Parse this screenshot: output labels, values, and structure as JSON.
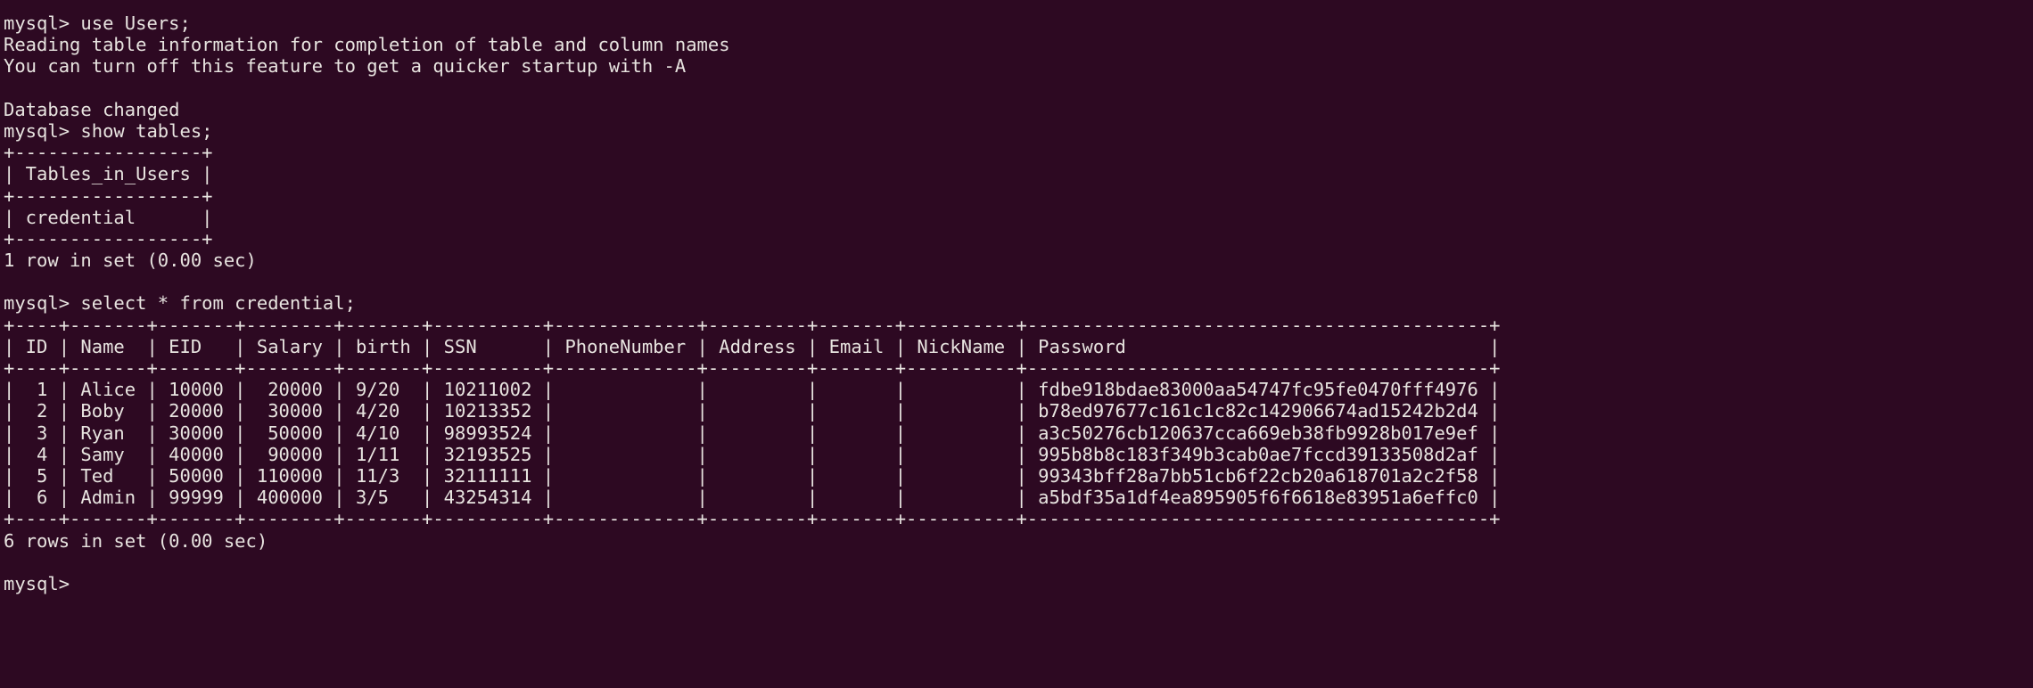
{
  "terminal": {
    "app": "mysql-client-terminal",
    "colors": {
      "background": "#2d0922",
      "foreground": "#e8e4e0"
    },
    "prompt": "mysql>",
    "lines": [
      "mysql> use Users;",
      "Reading table information for completion of table and column names",
      "You can turn off this feature to get a quicker startup with -A",
      "",
      "Database changed",
      "mysql> show tables;",
      "+-----------------+",
      "| Tables_in_Users |",
      "+-----------------+",
      "| credential      |",
      "+-----------------+",
      "1 row in set (0.00 sec)",
      "",
      "mysql> select * from credential;",
      "+----+-------+-------+--------+-------+----------+-------------+---------+-------+----------+------------------------------------------+",
      "| ID | Name  | EID   | Salary | birth | SSN      | PhoneNumber | Address | Email | NickName | Password                                 |",
      "+----+-------+-------+--------+-------+----------+-------------+---------+-------+----------+------------------------------------------+",
      "|  1 | Alice | 10000 |  20000 | 9/20  | 10211002 |             |         |       |          | fdbe918bdae83000aa54747fc95fe0470fff4976 |",
      "|  2 | Boby  | 20000 |  30000 | 4/20  | 10213352 |             |         |       |          | b78ed97677c161c1c82c142906674ad15242b2d4 |",
      "|  3 | Ryan  | 30000 |  50000 | 4/10  | 98993524 |             |         |       |          | a3c50276cb120637cca669eb38fb9928b017e9ef |",
      "|  4 | Samy  | 40000 |  90000 | 1/11  | 32193525 |             |         |       |          | 995b8b8c183f349b3cab0ae7fccd39133508d2af |",
      "|  5 | Ted   | 50000 | 110000 | 11/3  | 32111111 |             |         |       |          | 99343bff28a7bb51cb6f22cb20a618701a2c2f58 |",
      "|  6 | Admin | 99999 | 400000 | 3/5   | 43254314 |             |         |       |          | a5bdf35a1df4ea895905f6f6618e83951a6effc0 |",
      "+----+-------+-------+--------+-------+----------+-------------+---------+-------+----------+------------------------------------------+",
      "6 rows in set (0.00 sec)",
      "",
      "mysql> "
    ],
    "commands": [
      {
        "prompt": "mysql>",
        "text": "use Users;"
      },
      {
        "prompt": "mysql>",
        "text": "show tables;"
      },
      {
        "prompt": "mysql>",
        "text": "select * from credential;"
      },
      {
        "prompt": "mysql>",
        "text": ""
      }
    ],
    "messages": {
      "reading_table_info": "Reading table information for completion of table and column names",
      "turn_off_feature": "You can turn off this feature to get a quicker startup with -A",
      "database_changed": "Database changed",
      "one_row_in_set": "1 row in set (0.00 sec)",
      "six_rows_in_set": "6 rows in set (0.00 sec)"
    },
    "show_tables_result": {
      "header": "Tables_in_Users",
      "rows": [
        "credential"
      ]
    },
    "credential_table": {
      "columns": [
        "ID",
        "Name",
        "EID",
        "Salary",
        "birth",
        "SSN",
        "PhoneNumber",
        "Address",
        "Email",
        "NickName",
        "Password"
      ],
      "rows": [
        [
          "1",
          "Alice",
          "10000",
          "20000",
          "9/20",
          "10211002",
          "",
          "",
          "",
          "",
          "fdbe918bdae83000aa54747fc95fe0470fff4976"
        ],
        [
          "2",
          "Boby",
          "20000",
          "30000",
          "4/20",
          "10213352",
          "",
          "",
          "",
          "",
          "b78ed97677c161c1c82c142906674ad15242b2d4"
        ],
        [
          "3",
          "Ryan",
          "30000",
          "50000",
          "4/10",
          "98993524",
          "",
          "",
          "",
          "",
          "a3c50276cb120637cca669eb38fb9928b017e9ef"
        ],
        [
          "4",
          "Samy",
          "40000",
          "90000",
          "1/11",
          "32193525",
          "",
          "",
          "",
          "",
          "995b8b8c183f349b3cab0ae7fccd39133508d2af"
        ],
        [
          "5",
          "Ted",
          "50000",
          "110000",
          "11/3",
          "32111111",
          "",
          "",
          "",
          "",
          "99343bff28a7bb51cb6f22cb20a618701a2c2f58"
        ],
        [
          "6",
          "Admin",
          "99999",
          "400000",
          "3/5",
          "43254314",
          "",
          "",
          "",
          "",
          "a5bdf35a1df4ea895905f6f6618e83951a6effc0"
        ]
      ]
    }
  }
}
